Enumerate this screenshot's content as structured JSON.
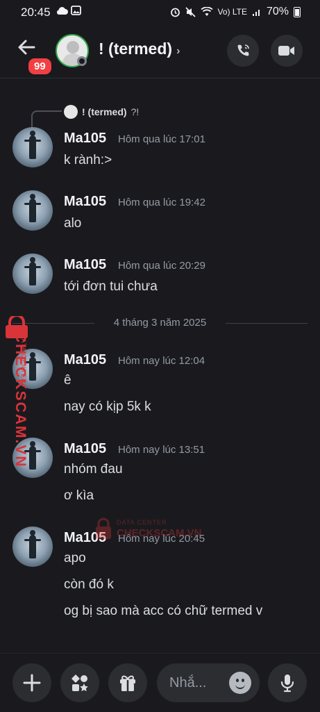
{
  "status_bar": {
    "time": "20:45",
    "left_icons": [
      "cloud-icon",
      "image-icon"
    ],
    "right_icons": [
      "alarm-icon",
      "mute-icon",
      "wifi-icon",
      "volte-icon",
      "signal-icon"
    ],
    "volte": "Vo) LTE",
    "battery": "70%"
  },
  "header": {
    "unread_badge": "99",
    "channel_name": "! (termed)",
    "chevron": "›",
    "call_icon": "phone-icon",
    "video_icon": "video-icon"
  },
  "reply_preview": {
    "name": "! (termed)",
    "text": "?!"
  },
  "messages": [
    {
      "author": "Ma105",
      "time": "Hôm qua lúc 17:01",
      "lines": [
        "k rành:>"
      ]
    },
    {
      "author": "Ma105",
      "time": "Hôm qua lúc 19:42",
      "lines": [
        "alo"
      ]
    },
    {
      "author": "Ma105",
      "time": "Hôm qua lúc 20:29",
      "lines": [
        "tới đơn tui chưa"
      ]
    },
    {
      "author": "Ma105",
      "time": "Hôm nay lúc 12:04",
      "lines": [
        "ê",
        "nay có kịp 5k k"
      ]
    },
    {
      "author": "Ma105",
      "time": "Hôm nay lúc 13:51",
      "lines": [
        "nhóm đau",
        "ơ kìa"
      ]
    },
    {
      "author": "Ma105",
      "time": "Hôm nay lúc 20:45",
      "lines": [
        "apo",
        "còn đó k",
        "og bị sao mà acc có chữ termed v"
      ]
    }
  ],
  "date_divider": "4 tháng 3 năm 2025",
  "watermark": {
    "title": "CHECKSCAM.VN",
    "subtitle": "DATA CENTER"
  },
  "composer": {
    "placeholder": "Nhắ...",
    "buttons": [
      "plus-icon",
      "apps-icon",
      "gift-icon",
      "emoji-icon",
      "microphone-icon"
    ]
  },
  "colors": {
    "background": "#1a1a1e",
    "badge": "#f23f43",
    "online_ring": "#2fa64a",
    "watermark": "#d8343a"
  }
}
